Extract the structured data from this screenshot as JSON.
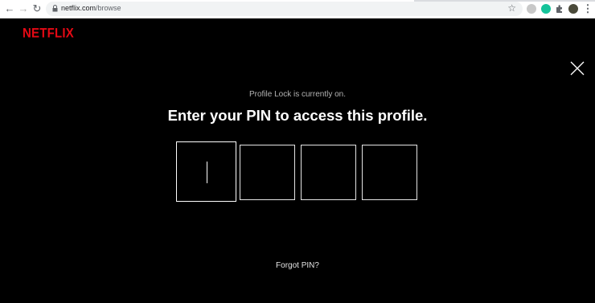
{
  "browser": {
    "url_host": "netflix.com",
    "url_path": "/browse",
    "icons": [
      "back-icon",
      "forward-icon",
      "reload-icon",
      "lock-icon",
      "star-icon",
      "extension-icon",
      "profile-avatar",
      "menu-icon"
    ]
  },
  "header": {
    "logo_text": "NETFLIX"
  },
  "profile_lock": {
    "status_text": "Profile Lock is currently on.",
    "title": "Enter your PIN to access this profile.",
    "pin_inputs": [
      "",
      "",
      "",
      ""
    ],
    "forgot_label": "Forgot PIN?"
  },
  "colors": {
    "brand": "#e50914",
    "background": "#000000",
    "text": "#ffffff"
  }
}
